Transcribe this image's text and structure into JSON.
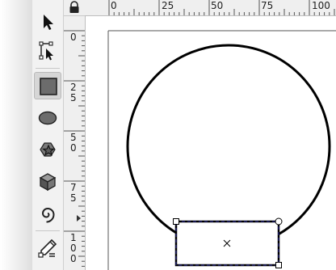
{
  "toolbox": {
    "tools": [
      {
        "name": "Selector",
        "icon": "selector-arrow-icon",
        "active": false
      },
      {
        "name": "Node editor",
        "icon": "node-editor-icon",
        "active": false
      },
      {
        "name": "Rectangle",
        "icon": "rectangle-icon",
        "active": true
      },
      {
        "name": "Ellipse",
        "icon": "ellipse-icon",
        "active": false
      },
      {
        "name": "Star / Polygon",
        "icon": "star-polygon-icon",
        "active": false
      },
      {
        "name": "3D box",
        "icon": "3d-box-icon",
        "active": false
      },
      {
        "name": "Spiral",
        "icon": "spiral-icon",
        "active": false
      },
      {
        "name": "Pencil / Pen",
        "icon": "pencil-pen-icon",
        "active": false
      }
    ]
  },
  "rulers": {
    "horizontal_labels": [
      "0",
      "25",
      "50",
      "75",
      "100"
    ],
    "vertical_labels": [
      "0",
      "2",
      "5",
      "5",
      "0",
      "7",
      "5",
      "1",
      "0",
      "0"
    ],
    "lock_icon": "lock-icon"
  },
  "colors": {
    "toolbox_bg": "#f2f2f2",
    "ruler_bg": "#efefef",
    "active_tool_bg": "#d6d6d6",
    "shape_stroke": "#000000",
    "selection_dash": "#1a1a8a"
  }
}
